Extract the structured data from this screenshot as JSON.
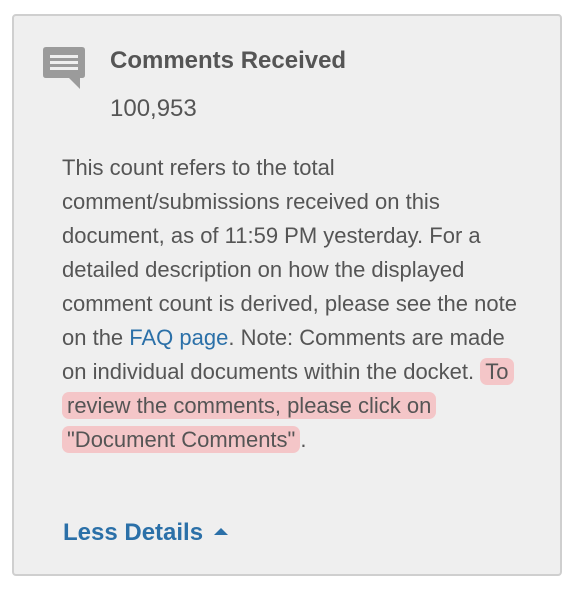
{
  "panel": {
    "title": "Comments Received",
    "count": "100,953",
    "description": {
      "part1": "This count refers to the total comment/submissions received on this document, as of 11:59 PM yesterday. For a detailed description on how the displayed comment count is derived, please see the note on the ",
      "faq_link": "FAQ page",
      "part2": ". Note: Comments are made on individual documents within the docket. ",
      "highlighted": "To review the comments, please click on \"Document Comments\"",
      "part3": "."
    },
    "toggle_label": "Less Details"
  },
  "colors": {
    "card_background": "#efefef",
    "card_border": "#cfcfcf",
    "text": "#555555",
    "link": "#2b70a8",
    "highlight": "#f4c6c8",
    "icon": "#9b9b9b"
  },
  "icons": {
    "comment": "comment-bubble-icon",
    "toggle": "caret-up-icon"
  }
}
